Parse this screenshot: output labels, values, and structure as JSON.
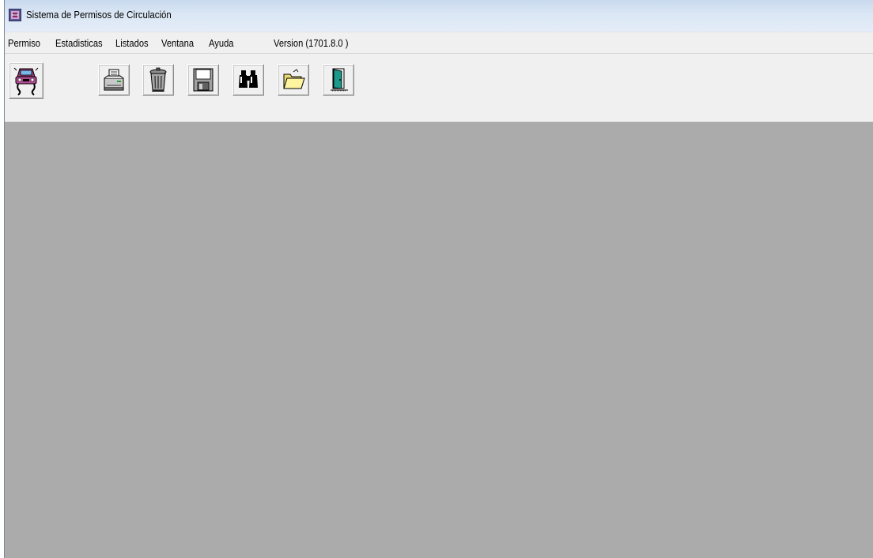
{
  "window": {
    "title": "Sistema de Permisos de Circulación"
  },
  "menu": {
    "items": [
      {
        "label": "Permiso"
      },
      {
        "label": "Estadisticas"
      },
      {
        "label": "Listados"
      },
      {
        "label": "Ventana"
      },
      {
        "label": "Ayuda"
      }
    ],
    "version": "Version (1701.8.0 )"
  },
  "toolbar": {
    "buttons": [
      {
        "icon": "car-icon"
      },
      {
        "icon": "printer-icon"
      },
      {
        "icon": "trash-icon"
      },
      {
        "icon": "save-icon"
      },
      {
        "icon": "binoculars-icon"
      },
      {
        "icon": "folder-icon"
      },
      {
        "icon": "exit-door-icon"
      }
    ]
  },
  "colors": {
    "client_area": "#ababab",
    "toolbar_bg": "#f0f0f0",
    "titlebar": "#dbe7f5"
  }
}
